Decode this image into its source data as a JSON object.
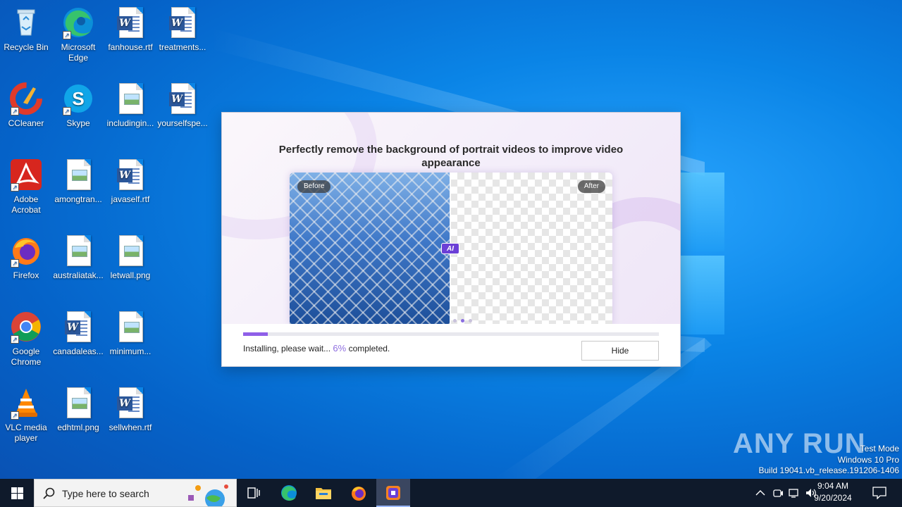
{
  "desktop": {
    "icons": [
      {
        "label": "Recycle Bin",
        "icon": "recycle-bin-icon"
      },
      {
        "label": "Microsoft Edge",
        "icon": "edge-icon"
      },
      {
        "label": "fanhouse.rtf",
        "icon": "word-doc-icon"
      },
      {
        "label": "treatments...",
        "icon": "word-doc-icon"
      },
      {
        "label": "CCleaner",
        "icon": "ccleaner-icon"
      },
      {
        "label": "Skype",
        "icon": "skype-icon"
      },
      {
        "label": "includingin...",
        "icon": "image-file-icon"
      },
      {
        "label": "yourselfspe...",
        "icon": "word-doc-icon"
      },
      {
        "label": "Adobe Acrobat",
        "icon": "acrobat-icon"
      },
      {
        "label": "amongtran...",
        "icon": "image-file-icon"
      },
      {
        "label": "javaself.rtf",
        "icon": "word-doc-icon"
      },
      {
        "label": "Firefox",
        "icon": "firefox-icon"
      },
      {
        "label": "australiatak...",
        "icon": "image-file-icon"
      },
      {
        "label": "letwall.png",
        "icon": "image-file-icon"
      },
      {
        "label": "Google Chrome",
        "icon": "chrome-icon"
      },
      {
        "label": "canadaleas...",
        "icon": "word-doc-icon"
      },
      {
        "label": "minimum...",
        "icon": "image-file-icon"
      },
      {
        "label": "VLC media player",
        "icon": "vlc-icon"
      },
      {
        "label": "edhtml.png",
        "icon": "image-file-icon"
      },
      {
        "label": "sellwhen.rtf",
        "icon": "word-doc-icon"
      }
    ]
  },
  "installer": {
    "headline": "Perfectly remove the background of portrait videos to improve video appearance",
    "before_label": "Before",
    "after_label": "After",
    "ai_label": "AI",
    "status_prefix": "Installing, please wait...",
    "progress_percent": "6%",
    "progress_value": 6,
    "status_suffix": "completed.",
    "hide_button": "Hide",
    "accent_color": "#8f5fe8"
  },
  "watermark": {
    "brand": "ANY RUN",
    "line1": "Test Mode",
    "line2": "Windows 10 Pro",
    "line3": "Build 19041.vb_release.191206-1406"
  },
  "taskbar": {
    "search_placeholder": "Type here to search",
    "time": "9:04 AM",
    "date": "9/20/2024",
    "apps": [
      "task-view-icon",
      "edge-icon",
      "file-explorer-icon",
      "firefox-icon",
      "installer-app-icon"
    ]
  }
}
